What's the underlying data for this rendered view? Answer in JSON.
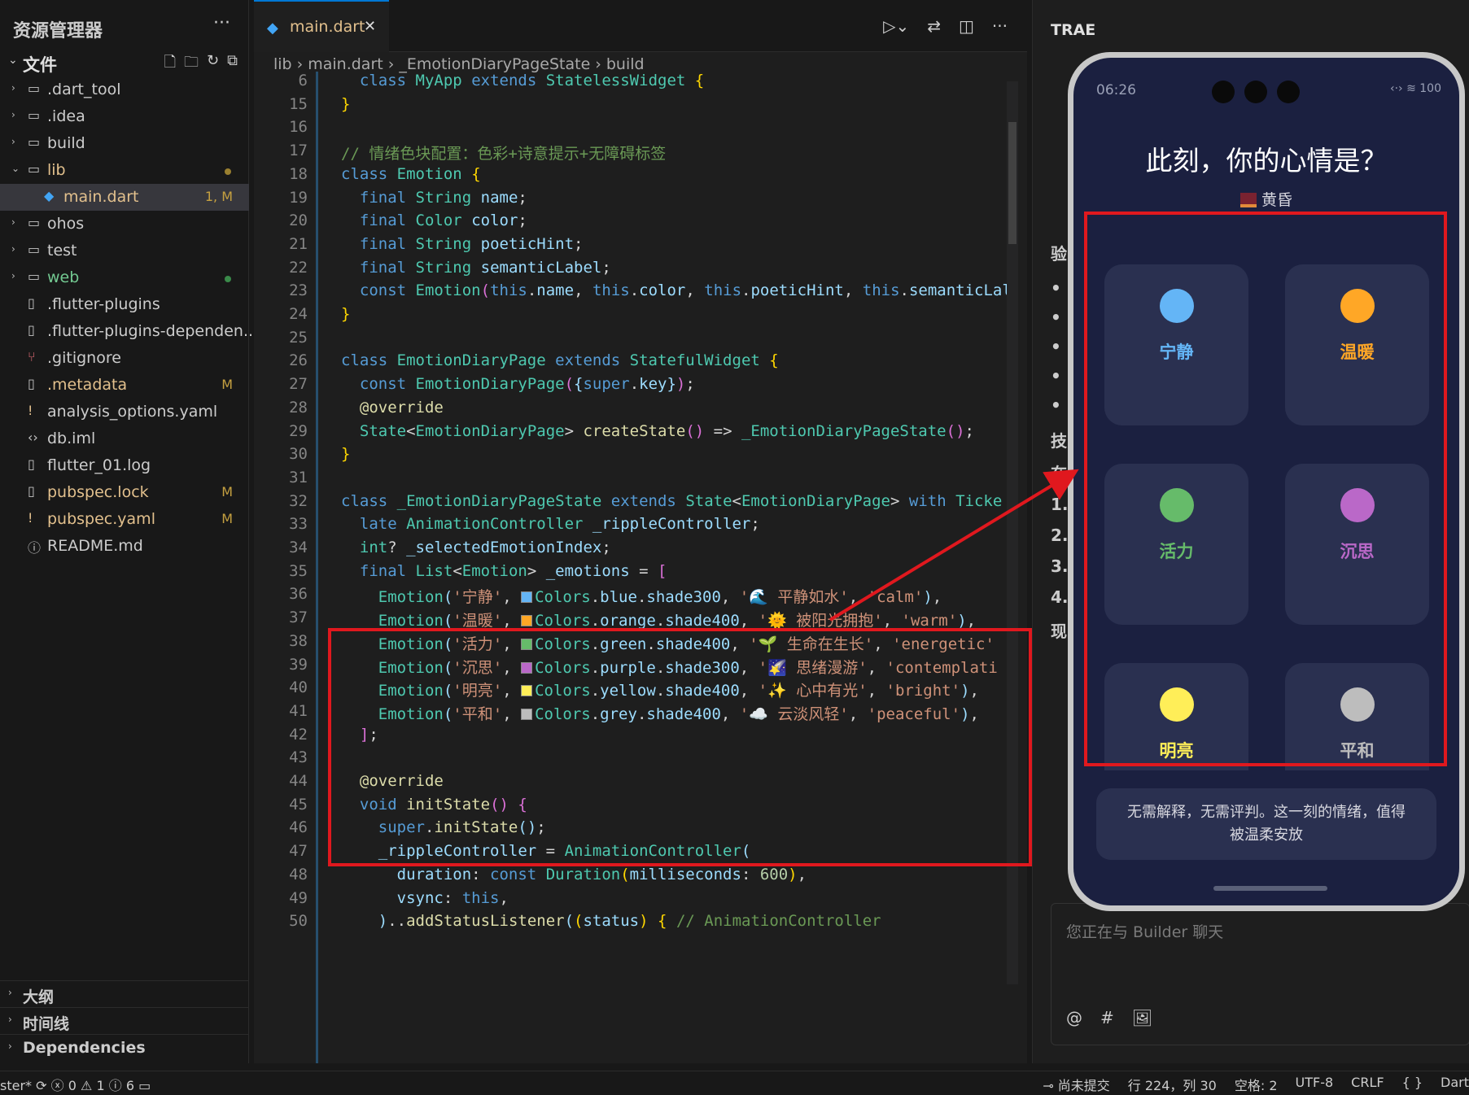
{
  "explorer": {
    "title": "资源管理器",
    "more": "···",
    "section_label": "文件",
    "items": [
      {
        "name": ".dart_tool",
        "type": "folder",
        "indent": 0
      },
      {
        "name": ".idea",
        "type": "folder",
        "indent": 0
      },
      {
        "name": "build",
        "type": "folder",
        "indent": 0
      },
      {
        "name": "lib",
        "type": "folder-open",
        "indent": 0,
        "color": "#e2c08d",
        "dot": "#9a8030"
      },
      {
        "name": "main.dart",
        "type": "dart",
        "indent": 1,
        "color": "#e2c08d",
        "badge": "1, M",
        "selected": true
      },
      {
        "name": "ohos",
        "type": "folder",
        "indent": 0
      },
      {
        "name": "test",
        "type": "folder",
        "indent": 0
      },
      {
        "name": "web",
        "type": "folder",
        "indent": 0,
        "color": "#73c991",
        "dot": "#3a8a4a"
      },
      {
        "name": ".flutter-plugins",
        "type": "file",
        "indent": 0
      },
      {
        "name": ".flutter-plugins-dependen...",
        "type": "file",
        "indent": 0
      },
      {
        "name": ".gitignore",
        "type": "git",
        "indent": 0
      },
      {
        "name": ".metadata",
        "type": "file",
        "indent": 0,
        "color": "#e2c08d",
        "badge": "M"
      },
      {
        "name": "analysis_options.yaml",
        "type": "yaml",
        "indent": 0
      },
      {
        "name": "db.iml",
        "type": "xml",
        "indent": 0
      },
      {
        "name": "flutter_01.log",
        "type": "file",
        "indent": 0
      },
      {
        "name": "pubspec.lock",
        "type": "file",
        "indent": 0,
        "color": "#e2c08d",
        "badge": "M"
      },
      {
        "name": "pubspec.yaml",
        "type": "yaml",
        "indent": 0,
        "color": "#e2c08d",
        "badge": "M"
      },
      {
        "name": "README.md",
        "type": "info",
        "indent": 0
      }
    ],
    "bottom_sections": [
      "大纲",
      "时间线",
      "Dependencies"
    ]
  },
  "editor": {
    "tab_name": "main.dart",
    "breadcrumb": [
      "lib",
      "main.dart",
      "_EmotionDiaryPageState",
      "build"
    ],
    "lines": [
      {
        "n": "6",
        "h": "  <span class=\"kw\">class</span> <span class=\"ty\">MyApp</span> <span class=\"kw\">extends</span> <span class=\"ty\">StatelessWidget</span> <span class=\"br1\">{</span>"
      },
      {
        "n": "15",
        "h": "<span class=\"br1\">}</span>"
      },
      {
        "n": "16",
        "h": ""
      },
      {
        "n": "17",
        "h": "<span class=\"cm\">// 情绪色块配置：色彩+诗意提示+无障碍标签</span>"
      },
      {
        "n": "18",
        "h": "<span class=\"kw\">class</span> <span class=\"ty\">Emotion</span> <span class=\"br1\">{</span>"
      },
      {
        "n": "19",
        "h": "  <span class=\"kw\">final</span> <span class=\"ty\">String</span> <span class=\"pr\">name</span>;"
      },
      {
        "n": "20",
        "h": "  <span class=\"kw\">final</span> <span class=\"ty\">Color</span> <span class=\"pr\">color</span>;"
      },
      {
        "n": "21",
        "h": "  <span class=\"kw\">final</span> <span class=\"ty\">String</span> <span class=\"pr\">poeticHint</span>;"
      },
      {
        "n": "22",
        "h": "  <span class=\"kw\">final</span> <span class=\"ty\">String</span> <span class=\"pr\">semanticLabel</span>;"
      },
      {
        "n": "23",
        "h": "  <span class=\"kw\">const</span> <span class=\"ty\">Emotion</span><span class=\"br2\">(</span><span class=\"kw\">this</span>.<span class=\"pr\">name</span>, <span class=\"kw\">this</span>.<span class=\"pr\">color</span>, <span class=\"kw\">this</span>.<span class=\"pr\">poeticHint</span>, <span class=\"kw\">this</span>.<span class=\"pr\">semanticLal</span>"
      },
      {
        "n": "24",
        "h": "<span class=\"br1\">}</span>"
      },
      {
        "n": "25",
        "h": ""
      },
      {
        "n": "26",
        "h": "<span class=\"kw\">class</span> <span class=\"ty\">EmotionDiaryPage</span> <span class=\"kw\">extends</span> <span class=\"ty\">StatefulWidget</span> <span class=\"br1\">{</span>"
      },
      {
        "n": "27",
        "h": "  <span class=\"kw\">const</span> <span class=\"ty\">EmotionDiaryPage</span><span class=\"br2\">(</span><span class=\"pr\">{</span><span class=\"kw\">super</span>.<span class=\"pr\">key</span><span class=\"pr\">}</span><span class=\"br2\">)</span>;"
      },
      {
        "n": "28",
        "h": "  <span class=\"fn\">@override</span>"
      },
      {
        "n": "29",
        "h": "  <span class=\"ty\">State</span>&lt;<span class=\"ty\">EmotionDiaryPage</span>&gt; <span class=\"fn\">createState</span><span class=\"br2\">()</span> =&gt; <span class=\"ty\">_EmotionDiaryPageState</span><span class=\"br2\">()</span>;"
      },
      {
        "n": "30",
        "h": "<span class=\"br1\">}</span>"
      },
      {
        "n": "31",
        "h": ""
      },
      {
        "n": "32",
        "h": "<span class=\"kw\">class</span> <span class=\"ty\">_EmotionDiaryPageState</span> <span class=\"kw\">extends</span> <span class=\"ty\">State</span>&lt;<span class=\"ty\">EmotionDiaryPage</span>&gt; <span class=\"kw\">with</span> <span class=\"ty\">Ticke</span>"
      },
      {
        "n": "33",
        "h": "  <span class=\"kw\">late</span> <span class=\"ty\">AnimationController</span> <span class=\"pr\">_rippleController</span>;"
      },
      {
        "n": "34",
        "h": "  <span class=\"ty\">int</span>? <span class=\"pr\">_selectedEmotionIndex</span>;"
      },
      {
        "n": "35",
        "h": "  <span class=\"kw\">final</span> <span class=\"ty\">List</span>&lt;<span class=\"ty\">Emotion</span>&gt; <span class=\"pr\">_emotions</span> = <span class=\"br2\">[</span>"
      },
      {
        "n": "36",
        "h": "    <span class=\"ty\">Emotion</span><span class=\"pr\">(</span><span class=\"st\">'宁静'</span>, <span class=\"sq\" style=\"background:#64b5f6\"></span><span class=\"ty\">Colors</span>.<span class=\"pr\">blue</span>.<span class=\"pr\">shade300</span>, <span class=\"st\">'🌊 平静如水'</span>, <span class=\"st\">'calm'</span><span class=\"pr\">)</span>,"
      },
      {
        "n": "37",
        "h": "    <span class=\"ty\">Emotion</span><span class=\"pr\">(</span><span class=\"st\">'温暖'</span>, <span class=\"sq\" style=\"background:#ffa726\"></span><span class=\"ty\">Colors</span>.<span class=\"pr\">orange</span>.<span class=\"pr\">shade400</span>, <span class=\"st\">'🌞 被阳光拥抱'</span>, <span class=\"st\">'warm'</span><span class=\"pr\">)</span>,"
      },
      {
        "n": "38",
        "h": "    <span class=\"ty\">Emotion</span><span class=\"pr\">(</span><span class=\"st\">'活力'</span>, <span class=\"sq\" style=\"background:#66bb6a\"></span><span class=\"ty\">Colors</span>.<span class=\"pr\">green</span>.<span class=\"pr\">shade400</span>, <span class=\"st\">'🌱 生命在生长'</span>, <span class=\"st\">'energetic'</span>"
      },
      {
        "n": "39",
        "h": "    <span class=\"ty\">Emotion</span><span class=\"pr\">(</span><span class=\"st\">'沉思'</span>, <span class=\"sq\" style=\"background:#ba68c8\"></span><span class=\"ty\">Colors</span>.<span class=\"pr\">purple</span>.<span class=\"pr\">shade300</span>, <span class=\"st\">'🌠 思绪漫游'</span>, <span class=\"st\">'contemplati</span>"
      },
      {
        "n": "40",
        "h": "    <span class=\"ty\">Emotion</span><span class=\"pr\">(</span><span class=\"st\">'明亮'</span>, <span class=\"sq\" style=\"background:#ffee58\"></span><span class=\"ty\">Colors</span>.<span class=\"pr\">yellow</span>.<span class=\"pr\">shade400</span>, <span class=\"st\">'✨ 心中有光'</span>, <span class=\"st\">'bright'</span><span class=\"pr\">)</span>,"
      },
      {
        "n": "41",
        "h": "    <span class=\"ty\">Emotion</span><span class=\"pr\">(</span><span class=\"st\">'平和'</span>, <span class=\"sq\" style=\"background:#bdbdbd\"></span><span class=\"ty\">Colors</span>.<span class=\"pr\">grey</span>.<span class=\"pr\">shade400</span>, <span class=\"st\">'☁️ 云淡风轻'</span>, <span class=\"st\">'peaceful'</span><span class=\"pr\">)</span>,"
      },
      {
        "n": "42",
        "h": "  <span class=\"br2\">]</span>;"
      },
      {
        "n": "43",
        "h": ""
      },
      {
        "n": "44",
        "h": "  <span class=\"fn\">@override</span>"
      },
      {
        "n": "45",
        "h": "  <span class=\"kw\">void</span> <span class=\"fn\">initState</span><span class=\"br2\">()</span> <span class=\"br2\">{</span>"
      },
      {
        "n": "46",
        "h": "    <span class=\"kw\">super</span>.<span class=\"fn\">initState</span><span class=\"pr\">()</span>;"
      },
      {
        "n": "47",
        "h": "    <span class=\"pr\">_rippleController</span> = <span class=\"ty\">AnimationController</span><span class=\"pr\">(</span>"
      },
      {
        "n": "48",
        "h": "      <span class=\"pr\">duration</span>: <span class=\"kw\">const</span> <span class=\"ty\">Duration</span><span class=\"br1\">(</span><span class=\"pr\">milliseconds</span>: <span class=\"nm\">600</span><span class=\"br1\">)</span>,"
      },
      {
        "n": "49",
        "h": "      <span class=\"pr\">vsync</span>: <span class=\"kw\">this</span>,"
      },
      {
        "n": "50",
        "h": "    <span class=\"pr\">)</span>..<span class=\"fn\">addStatusListener</span><span class=\"pr\">(</span><span class=\"br1\">(</span><span class=\"pr\">status</span><span class=\"br1\">)</span> <span class=\"br1\">{</span> <span class=\"cm\">// AnimationController</span>"
      }
    ]
  },
  "right_panel": {
    "title": "TRAE",
    "edge_chars": [
      "验",
      "•",
      "•",
      "•",
      "•",
      "•",
      "技",
      "在",
      "1.",
      "2.",
      "3.",
      "4.",
      "现"
    ],
    "chat_placeholder": "您正在与 Builder 聊天",
    "chat_tools": [
      "@",
      "#",
      "🖼"
    ]
  },
  "phone": {
    "time": "06:26",
    "battery": "100",
    "title": "此刻，你的心情是？",
    "subtitle": "黄昏",
    "emotions": [
      {
        "label": "宁静",
        "color": "#64b5f6"
      },
      {
        "label": "温暖",
        "color": "#ffa726"
      },
      {
        "label": "活力",
        "color": "#66bb6a"
      },
      {
        "label": "沉思",
        "color": "#ba68c8"
      },
      {
        "label": "明亮",
        "color": "#ffee58"
      },
      {
        "label": "平和",
        "color": "#bdbdbd"
      }
    ],
    "quote": "无需解释，无需评判。这一刻的情绪，值得被温柔安放"
  },
  "statusbar": {
    "branch": "ster*",
    "errors": "0",
    "warnings": "1",
    "infos": "6",
    "uncommitted": "尚未提交",
    "position": "行 224，列 30",
    "spaces": "空格: 2",
    "encoding": "UTF-8",
    "eol": "CRLF",
    "braces": "{ }",
    "language": "Dart"
  },
  "colors": {
    "highlight": "#e0181e",
    "accent": "#0078d4"
  }
}
